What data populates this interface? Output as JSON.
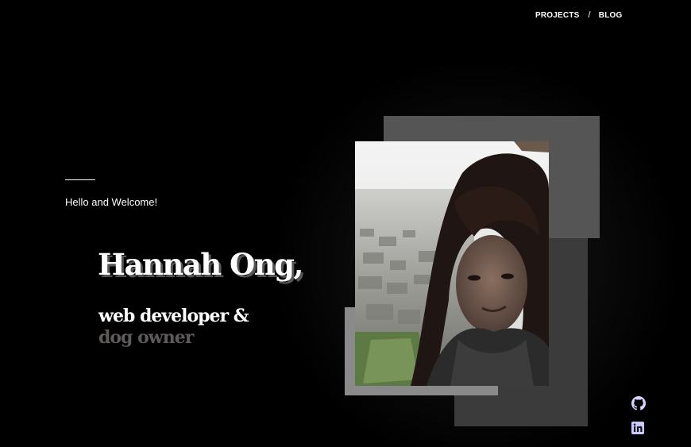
{
  "nav": {
    "projects_label": "PROJECTS",
    "separator": "/",
    "blog_label": "BLOG"
  },
  "hero": {
    "greeting": "Hello and Welcome!",
    "name": "Hannah Ong,",
    "role_line1": "web developer &",
    "role_line2": "dog owner"
  },
  "social": {
    "github_icon": "github-icon",
    "linkedin_icon": "linkedin-icon"
  },
  "colors": {
    "background": "#000000",
    "text": "#ffffff",
    "muted_text": "#5e5a5a",
    "box_top": "#555555",
    "box_bottom": "#3b3b3b",
    "box_left": "#8a8a8a",
    "icon_tint": "#c9c9ff"
  }
}
